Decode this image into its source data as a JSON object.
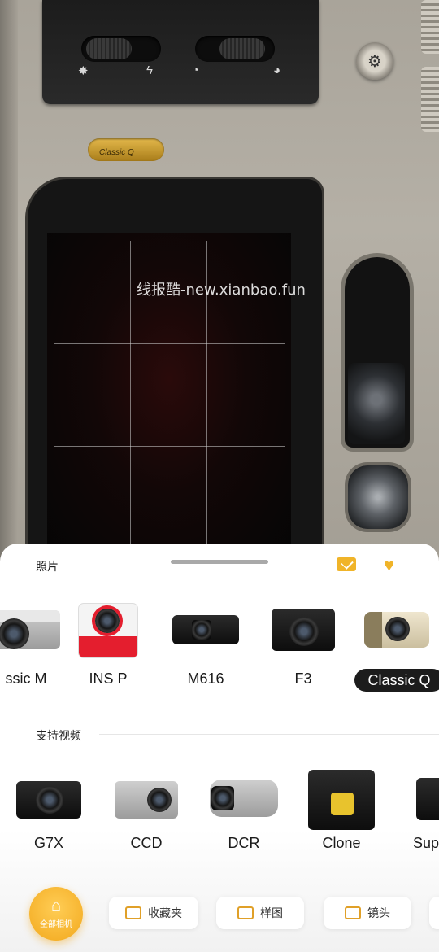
{
  "watermark": "线报酷-new.xianbao.fun",
  "camera_badge": "Classic Q",
  "sheet": {
    "title": "照片",
    "mail_icon": "mail-icon",
    "favorite_icon": "heart-icon"
  },
  "photo_cameras": [
    {
      "label": "ssic M",
      "selected": false
    },
    {
      "label": "INS P",
      "selected": false
    },
    {
      "label": "M616",
      "selected": false
    },
    {
      "label": "F3",
      "selected": false
    },
    {
      "label": "Classic Q",
      "selected": true
    }
  ],
  "video_section": {
    "title": "支持视频"
  },
  "video_cameras": [
    {
      "label": "G7X"
    },
    {
      "label": "CCD"
    },
    {
      "label": "DCR"
    },
    {
      "label": "Clone"
    },
    {
      "label": "Sup"
    }
  ],
  "bottom_bar": {
    "all_cameras": "全部相机",
    "favorites": "收藏夹",
    "samples": "样图",
    "lenses": "镜头"
  },
  "colors": {
    "accent": "#f2a81d",
    "selected_bg": "#1c1c1c"
  }
}
